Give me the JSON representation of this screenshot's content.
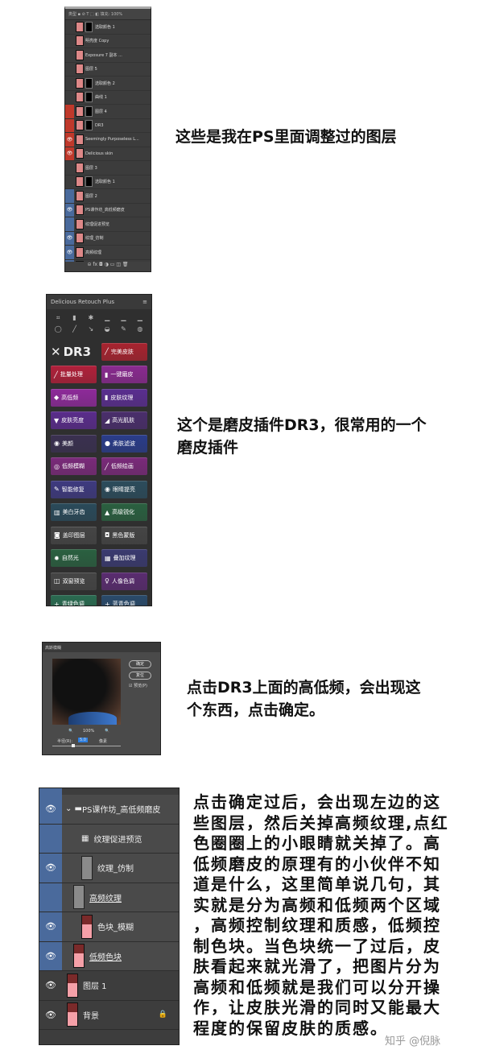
{
  "section1": {
    "caption": "这些是我在PS里面调整过的图层",
    "toolbar": "类型 ▪ ⊘ T ⬚ ◧ 填充: 100%",
    "layers": [
      {
        "name": "选取颜色 1",
        "vis": "",
        "mask": true,
        "color": ""
      },
      {
        "name": "明亮度 Copy",
        "vis": "",
        "mask": false,
        "color": ""
      },
      {
        "name": "Exposure 7 副本 ...",
        "vis": "",
        "mask": false,
        "color": ""
      },
      {
        "name": "图层 5",
        "vis": "",
        "mask": false,
        "color": ""
      },
      {
        "name": "选取颜色 2",
        "vis": "",
        "mask": true,
        "color": ""
      },
      {
        "name": "曲线 1",
        "vis": "",
        "mask": true,
        "color": ""
      },
      {
        "name": "图层 4",
        "vis": "",
        "mask": true,
        "color": "#c0392b"
      },
      {
        "name": "DR3",
        "vis": "",
        "mask": true,
        "color": "#c0392b"
      },
      {
        "name": "Seemingly Purposeless L...",
        "vis": "👁",
        "mask": false,
        "color": "#c0392b"
      },
      {
        "name": "Delicious skin",
        "vis": "👁",
        "mask": false,
        "color": "#c0392b"
      },
      {
        "name": "图层 3",
        "vis": "",
        "mask": false,
        "color": ""
      },
      {
        "name": "选取颜色 1",
        "vis": "",
        "mask": true,
        "color": ""
      },
      {
        "name": "图层 2",
        "vis": "",
        "mask": false,
        "color": "#4a6a9c"
      },
      {
        "name": "PS课作坊_高低频磨皮",
        "vis": "👁",
        "mask": false,
        "color": "#4a6a9c"
      },
      {
        "name": "纹理促进预览",
        "vis": "",
        "mask": false,
        "color": "#4a6a9c"
      },
      {
        "name": "纹理_仿制",
        "vis": "👁",
        "mask": false,
        "color": "#4a6a9c"
      },
      {
        "name": "高频纹理",
        "vis": "👁",
        "mask": false,
        "color": "#4a6a9c"
      },
      {
        "name": "色块_模糊",
        "vis": "👁",
        "mask": false,
        "color": "#4a6a9c"
      }
    ],
    "footer": "⊝ fx ◘ ◑ ▭ ◫ 🗑"
  },
  "section2": {
    "caption_lines": [
      "这个是磨皮插件DR3，很常用的一个",
      "磨皮插件"
    ],
    "panel_title": "Delicious Retouch Plus",
    "menu_icon": "≡",
    "tools": [
      "⌗",
      "▮",
      "✱",
      "▁",
      "▁",
      "▁",
      "◯",
      "╱",
      "↘",
      "◒",
      "✎",
      "◍"
    ],
    "logo": "DR3",
    "buttons": [
      {
        "label": "完美皮肤",
        "icon": "╱",
        "color": "#a8232f"
      },
      {
        "label": "批量处理",
        "icon": "╱",
        "color": "#b0203a"
      },
      {
        "label": "一键磨皮",
        "icon": "▮",
        "color": "#8a2a90"
      },
      {
        "label": "高低频",
        "icon": "◆",
        "color": "#8e2a9a"
      },
      {
        "label": "皮肤纹理",
        "icon": "▮",
        "color": "#5a2e90"
      },
      {
        "label": "皮肤亮度",
        "icon": "▼",
        "color": "#5a2c8c"
      },
      {
        "label": "高光肌肤",
        "icon": "◢",
        "color": "#4a2e6c"
      },
      {
        "label": "美颜",
        "icon": "◉",
        "color": "#3a3050"
      },
      {
        "label": "柔肤滤波",
        "icon": "●",
        "color": "#2a3c8a"
      },
      {
        "label": "低频模糊",
        "icon": "◎",
        "color": "#7a2a7a"
      },
      {
        "label": "低频绘画",
        "icon": "╱",
        "color": "#7a2a7a"
      },
      {
        "label": "智能修复",
        "icon": "✎",
        "color": "#3e3a80"
      },
      {
        "label": "眼睛提亮",
        "icon": "◉",
        "color": "#2c4c5c"
      },
      {
        "label": "美白牙齿",
        "icon": "▥",
        "color": "#2a4a5a"
      },
      {
        "label": "高级锐化",
        "icon": "▲",
        "color": "#2a6040"
      },
      {
        "label": "盖印图层",
        "icon": "◙",
        "color": "#454545"
      },
      {
        "label": "黑色蒙版",
        "icon": "◘",
        "color": "#454545"
      },
      {
        "label": "自然光",
        "icon": "✹",
        "color": "#2a6040"
      },
      {
        "label": "叠加纹理",
        "icon": "▦",
        "color": "#3a3a70"
      },
      {
        "label": "双窗预览",
        "icon": "◫",
        "color": "#454545"
      },
      {
        "label": "人像色调",
        "icon": "♀",
        "color": "#5a2c70"
      },
      {
        "label": "青绿色调",
        "icon": "+",
        "color": "#2a6a50"
      },
      {
        "label": "蓝青色调",
        "icon": "+",
        "color": "#2a4a6a"
      }
    ]
  },
  "section3": {
    "caption_lines": [
      "点击DR3上面的高低频，会出现这",
      "个东西，点击确定。"
    ],
    "dialog_title": "高斯模糊",
    "ok": "确定",
    "reset": "复位",
    "preview": "预览(P)",
    "zoom": "100%",
    "radius_label": "半径(R):",
    "radius_value": "5.0",
    "unit": "像素"
  },
  "section4": {
    "caption_lines": [
      "点击确定过后，会出现左边的这",
      "些图层，然后关掉高频纹理,点红",
      "色圈圈上的小眼睛就关掉了。高",
      "低频磨皮的原理有的小伙伴不知",
      "道是什么，这里简单说几句，其",
      "实就是分为高频和低频两个区域",
      "，高频控制纹理和质感，低频控",
      "制色块。当色块统一了过后，皮",
      "肤看起来就光滑了，把图片分为",
      "高频和低频就是我们可以分开操",
      "作，让皮肤光滑的同时又能最大",
      "程度的保留皮肤的质感。"
    ],
    "layers": [
      {
        "name": "PS课作坊_高低频磨皮",
        "vis": "👁",
        "thumb": "folder",
        "sel": true
      },
      {
        "name": "纹理促进预览",
        "vis": "",
        "thumb": "adj",
        "sel": true
      },
      {
        "name": "纹理_仿制",
        "vis": "👁",
        "thumb": "grey",
        "sel": true
      },
      {
        "name": "高频纹理",
        "vis": "",
        "thumb": "grey",
        "sel": true,
        "circled": true
      },
      {
        "name": "色块_模糊",
        "vis": "👁",
        "thumb": "photo",
        "sel": true
      },
      {
        "name": "低频色块",
        "vis": "👁",
        "thumb": "photo",
        "sel": true
      },
      {
        "name": "图层 1",
        "vis": "👁",
        "thumb": "photo",
        "sel": false
      },
      {
        "name": "背景",
        "vis": "👁",
        "thumb": "photo",
        "sel": false,
        "locked": true
      }
    ],
    "highlight_color": "#e01010"
  },
  "watermark": "知乎 @倪脉"
}
